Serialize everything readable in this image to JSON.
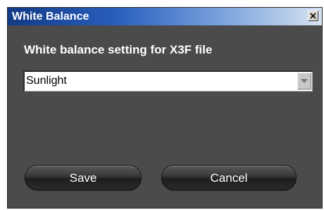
{
  "window": {
    "title": "White Balance",
    "close_icon": "close-x-icon"
  },
  "dialog": {
    "heading": "White balance setting for X3F file",
    "select": {
      "selected_value": "Sunlight",
      "arrow_icon": "dropdown-arrow-icon"
    },
    "buttons": {
      "save_label": "Save",
      "cancel_label": "Cancel"
    }
  },
  "colors": {
    "titlebar_start": "#123a86",
    "titlebar_end": "#d7e2f2",
    "dialog_background": "#4b4b4b",
    "button_background": "#2a2a2a",
    "text": "#ffffff"
  }
}
